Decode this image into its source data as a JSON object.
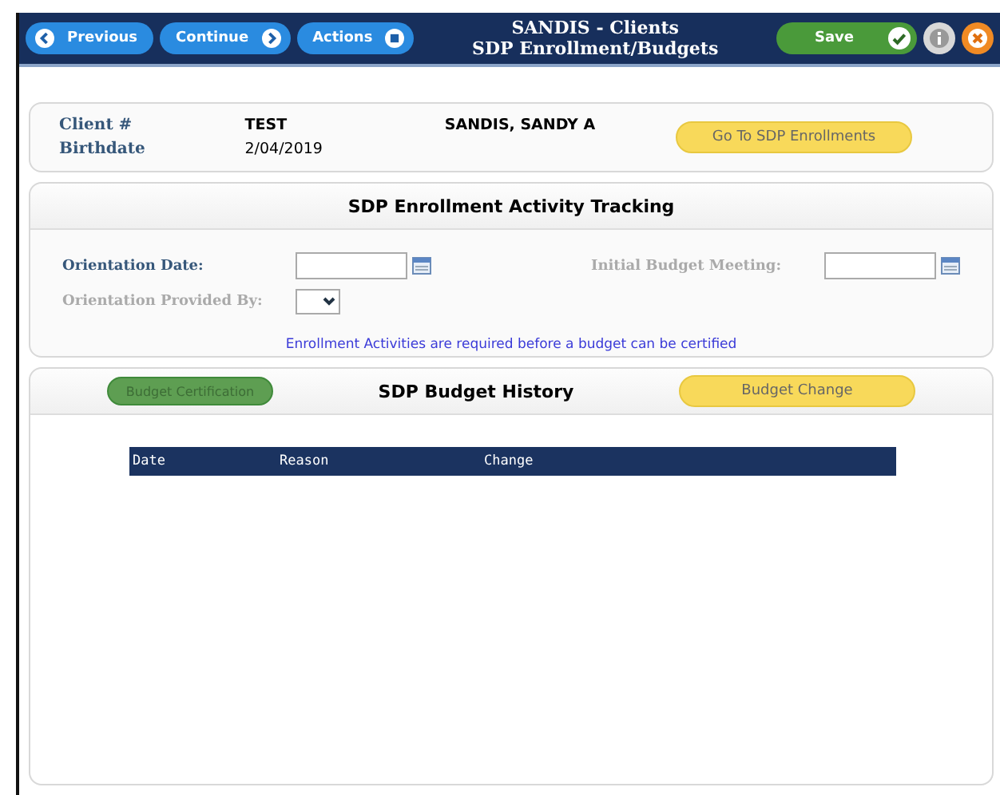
{
  "toolbar": {
    "buttons": [
      {
        "label": "Previous",
        "kind": "back"
      },
      {
        "label": "Continue",
        "kind": "forward"
      },
      {
        "label": "Actions",
        "kind": "menu"
      }
    ],
    "title": "SANDIS - Clients",
    "subtitle": "SDP Enrollment/Budgets",
    "save": "Save"
  },
  "client": {
    "number_label": "Client #",
    "number": "TEST",
    "name": "SANDIS, SANDY A",
    "birthdate_label": "Birthdate",
    "birthdate": "2/04/2019",
    "button": "Go To SDP Enrollments"
  },
  "tracking": {
    "title": "SDP Enrollment Activity Tracking",
    "orientation_date": {
      "label": "Orientation Date:",
      "disabled": false
    },
    "initial_budget": {
      "label": "Initial Budget Meeting:",
      "disabled": true
    },
    "provided_by": {
      "label": "Orientation Provided By:",
      "disabled": true
    },
    "note": "Enrollment Activities are required before a budget can be certified"
  },
  "history": {
    "title": "SDP Budget History",
    "certify_button": {
      "label": "Budget Certification",
      "disabled": true
    },
    "change_button": {
      "label": "Budget Change",
      "disabled": false
    },
    "columns": [
      "Date",
      "Reason",
      "Change"
    ]
  }
}
